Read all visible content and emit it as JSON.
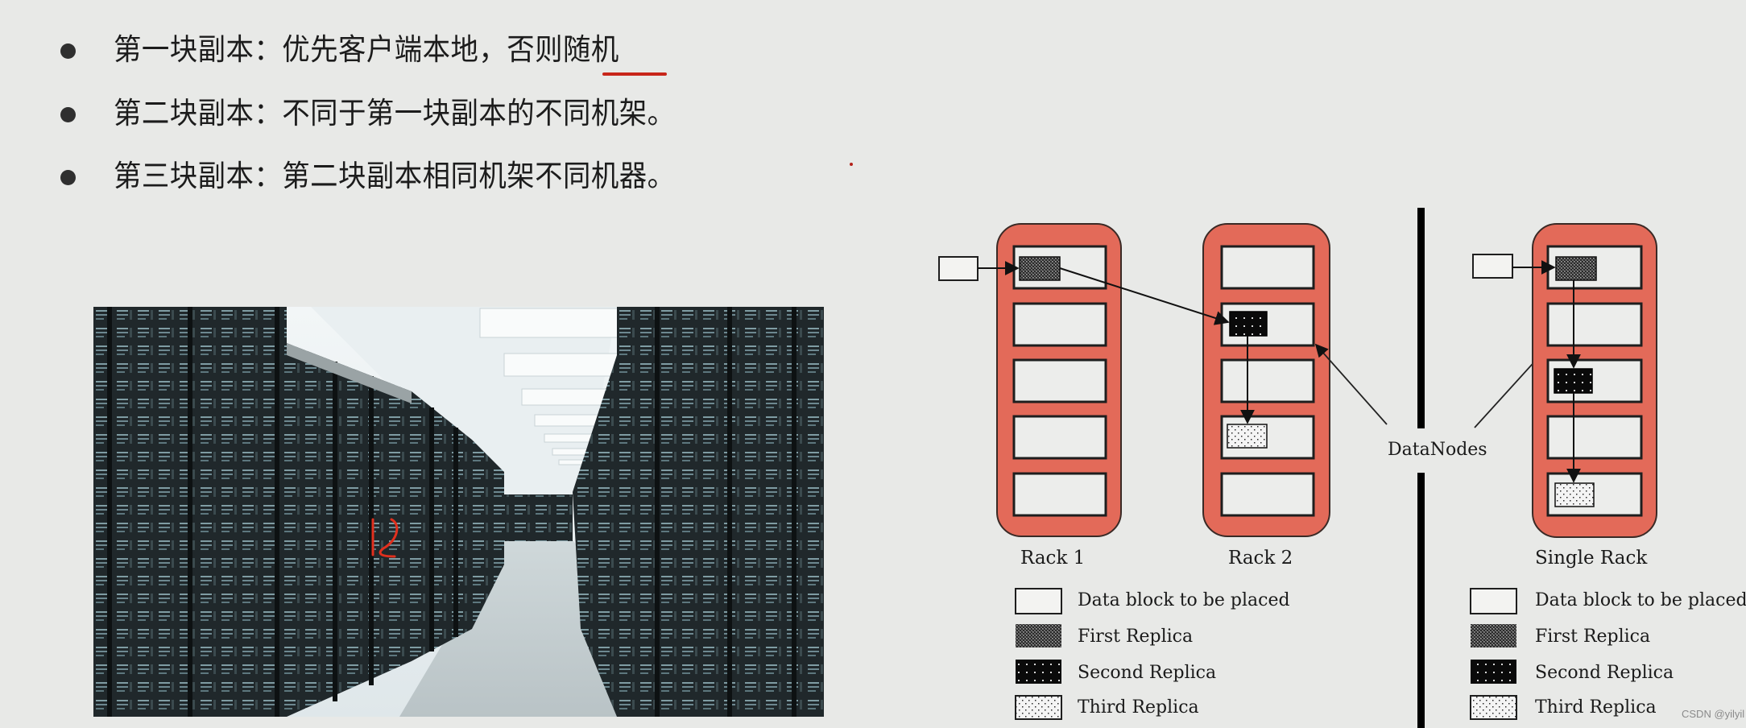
{
  "slide": {
    "bullets": [
      {
        "text": "第一块副本：优先客户端本地，否则随机"
      },
      {
        "text": "第二块副本：不同于第一块副本的不同机架。"
      },
      {
        "text": "第三块副本：第二块副本相同机架不同机器。"
      }
    ],
    "annotation_mark": "随机"
  },
  "photo": {
    "subject": "data center server aisle",
    "handwritten_annotation": "12"
  },
  "diagram": {
    "colors": {
      "rack_fill": "#e36a59",
      "rack_stroke": "#3a2a26",
      "slot_fill": "#ecedeb",
      "line": "#1a1a1a"
    },
    "left_panel": {
      "racks": [
        {
          "label": "Rack 1",
          "slots": 5,
          "contents": {
            "0": "first"
          }
        },
        {
          "label": "Rack 2",
          "slots": 5,
          "contents": {
            "1": "second",
            "3": "third"
          }
        }
      ]
    },
    "center_label": "DataNodes",
    "right_panel": {
      "racks": [
        {
          "label": "Single Rack",
          "slots": 5,
          "contents": {
            "0": "first",
            "2": "second",
            "4": "third"
          }
        }
      ]
    },
    "legend": [
      {
        "key": "block",
        "label": "Data block to be placed"
      },
      {
        "key": "first",
        "label": "First Replica"
      },
      {
        "key": "second",
        "label": "Second Replica"
      },
      {
        "key": "third",
        "label": "Third Replica"
      }
    ]
  },
  "watermark": "CSDN @yilyil"
}
